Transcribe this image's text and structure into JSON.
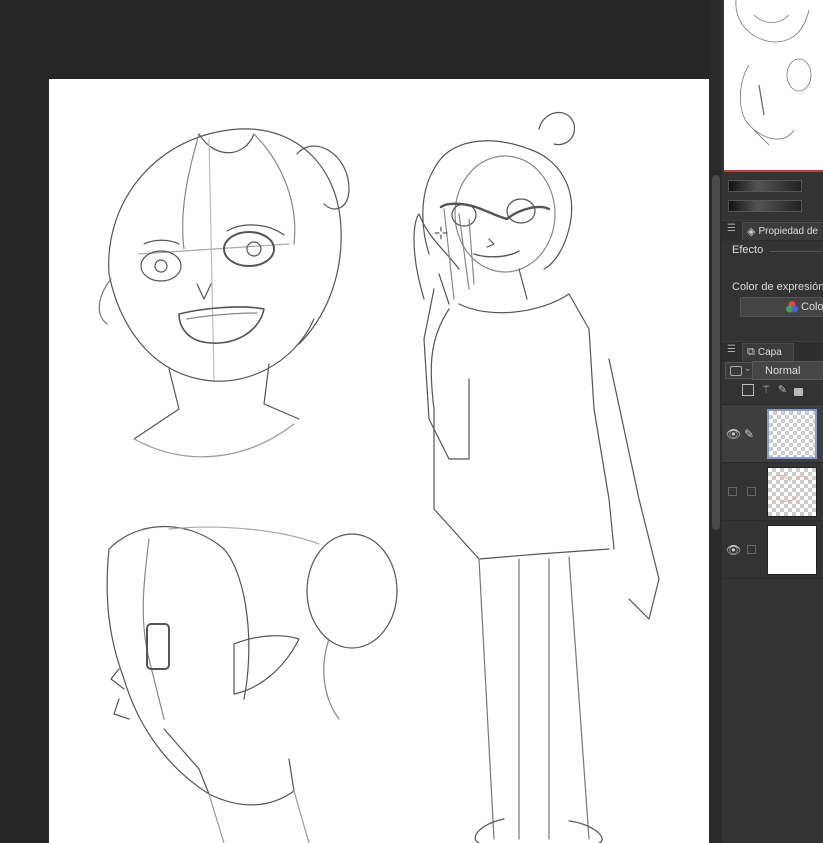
{
  "panel": {
    "tool_property_tab": {
      "label": "Propiedad de"
    },
    "effect_label": "Efecto",
    "expression_color_label": "Color de expresión",
    "color_button_label": "Colo",
    "layer_tab": {
      "label": "Capa"
    },
    "blend_mode": "Normal"
  },
  "layers": [
    {
      "visible": true,
      "editing": true,
      "selected": true,
      "thumbnail": "transparent"
    },
    {
      "visible": false,
      "editing": false,
      "selected": false,
      "thumbnail": "transparent-pink-sketch"
    },
    {
      "visible": true,
      "editing": false,
      "selected": false,
      "thumbnail": "white-paper"
    }
  ],
  "icons": {
    "tab_menu": "hamburger-icon",
    "tool_property": "tool-property-icon",
    "layer": "layers-icon",
    "expression_color": "color-wheel-icon",
    "visibility": "eye-icon",
    "editing": "pencil-icon",
    "layer_tools": [
      "clip-layer-icon",
      "reference-layer-icon",
      "draft-layer-icon",
      "lock-icon"
    ]
  },
  "colors": {
    "workspace": "#242424",
    "panel": "#333333",
    "canvas": "#ffffff",
    "navigator_accent": "#c04040"
  }
}
